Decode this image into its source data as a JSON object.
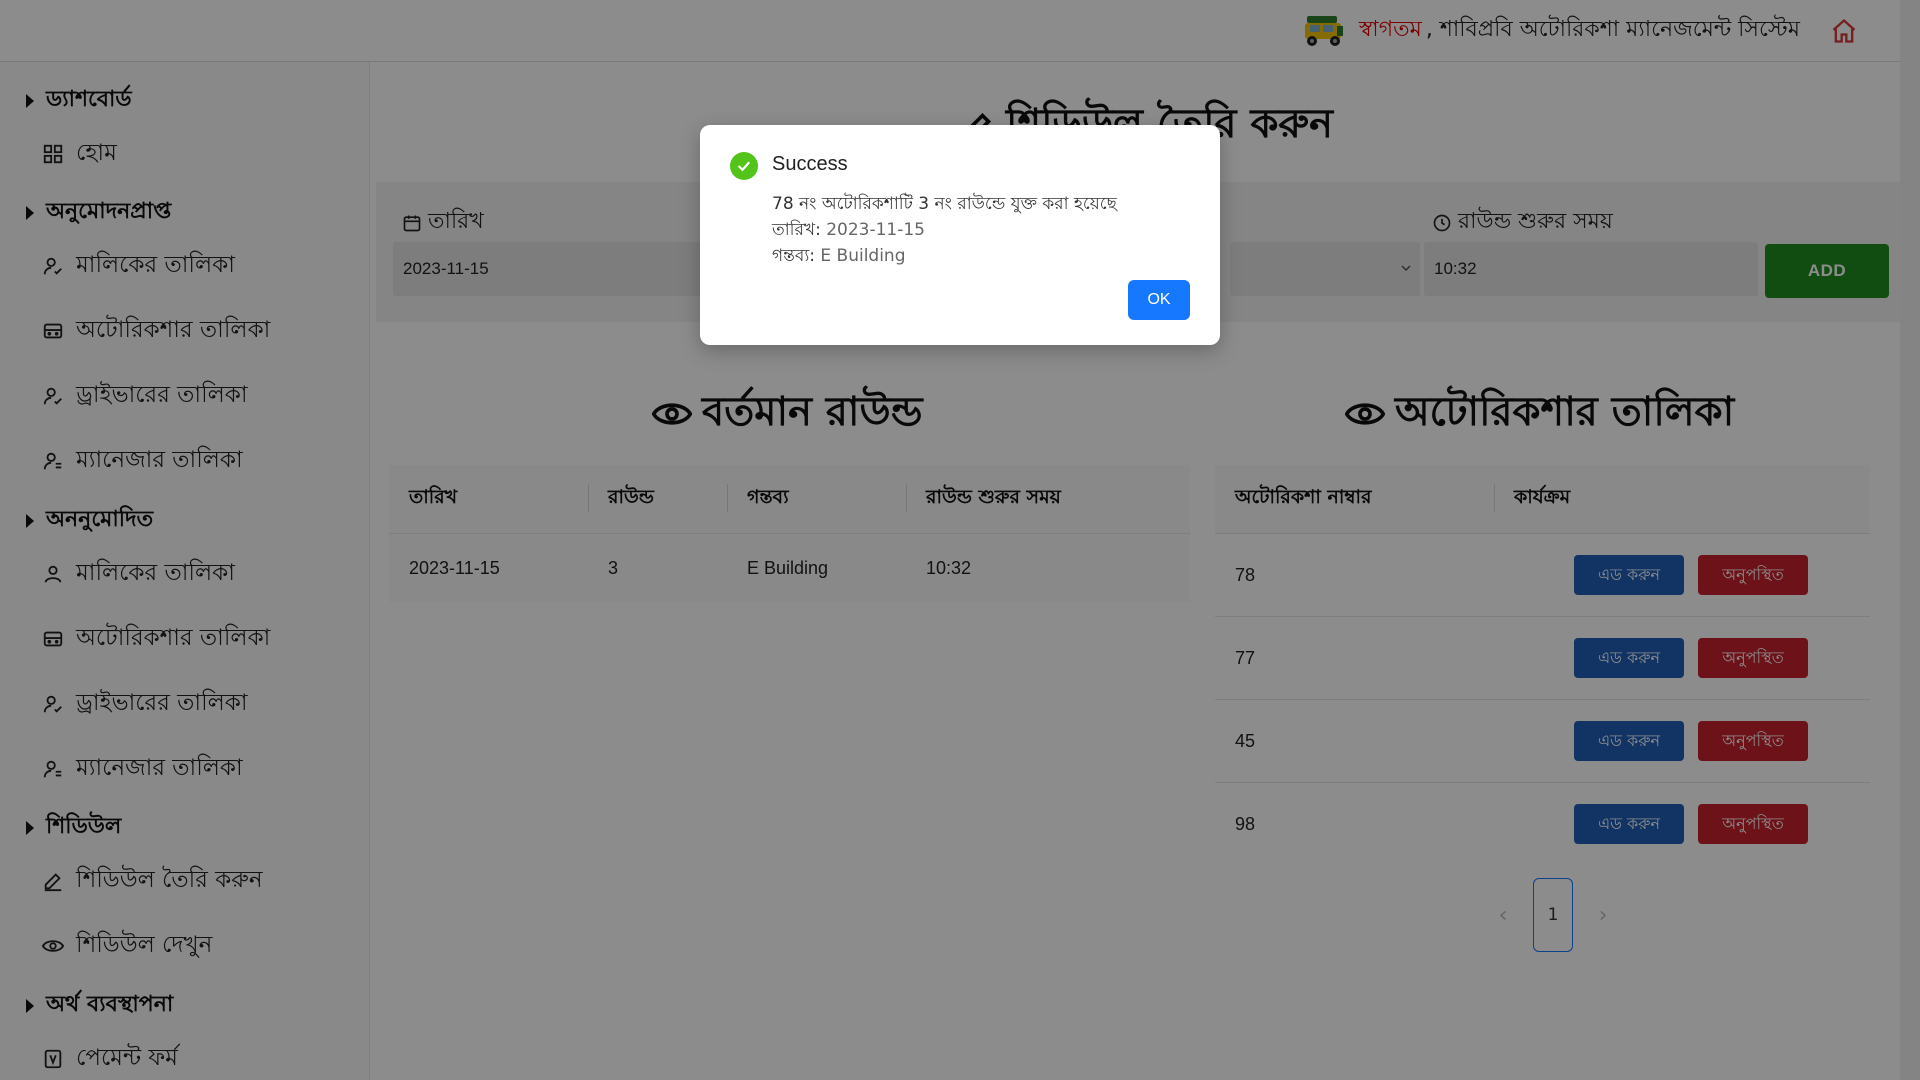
{
  "header": {
    "welcome": "স্বাগতম",
    "system_name": ", শাবিপ্রবি অটোরিকশা ম্যানেজমেন্ট সিস্টেম"
  },
  "sidebar": {
    "sections": [
      {
        "label": "ড্যাশবোর্ড",
        "items": [
          {
            "label": "হোম",
            "icon": "grid-icon"
          }
        ]
      },
      {
        "label": "অনুমোদনপ্রাপ্ত",
        "items": [
          {
            "label": "মালিকের তালিকা",
            "icon": "user-check-icon"
          },
          {
            "label": "অটোরিকশার তালিকা",
            "icon": "car-icon"
          },
          {
            "label": "ড্রাইভারের তালিকা",
            "icon": "user-check-icon"
          },
          {
            "label": "ম্যানেজার তালিকা",
            "icon": "user-settings-icon"
          }
        ]
      },
      {
        "label": "অননুমোদিত",
        "items": [
          {
            "label": "মালিকের তালিকা",
            "icon": "user-icon"
          },
          {
            "label": "অটোরিকশার তালিকা",
            "icon": "car-icon"
          },
          {
            "label": "ড্রাইভারের তালিকা",
            "icon": "user-check-icon"
          },
          {
            "label": "ম্যানেজার তালিকা",
            "icon": "user-settings-icon"
          }
        ]
      },
      {
        "label": "শিডিউল",
        "items": [
          {
            "label": "শিডিউল তৈরি করুন",
            "icon": "edit-icon"
          },
          {
            "label": "শিডিউল দেখুন",
            "icon": "eye-icon"
          }
        ]
      },
      {
        "label": "অর্থ ব্যবস্থাপনা",
        "items": [
          {
            "label": "পেমেন্ট ফর্ম",
            "icon": "taka-icon"
          }
        ]
      }
    ]
  },
  "main": {
    "page_title": "শিডিউল তৈরি করুন",
    "form": {
      "date_label": "তারিখ",
      "date_value": "2023-11-15",
      "time_label": "রাউন্ড শুরুর সময়",
      "time_value": "10:32",
      "add_label": "ADD"
    },
    "current_round": {
      "title": "বর্তমান রাউন্ড",
      "columns": [
        "তারিখ",
        "রাউন্ড",
        "গন্তব্য",
        "রাউন্ড শুরুর সময়"
      ],
      "rows": [
        [
          "2023-11-15",
          "3",
          "E Building",
          "10:32"
        ]
      ]
    },
    "autorickshaw_list": {
      "title": "অটোরিকশার তালিকা",
      "columns": [
        "অটোরিকশা নাম্বার",
        "কার্যক্রম"
      ],
      "add_btn": "এড করুন",
      "absent_btn": "অনুপস্থিত",
      "rows": [
        "78",
        "77",
        "45",
        "98"
      ]
    },
    "pagination": {
      "current": "1",
      "prev": "‹",
      "next": "›"
    }
  },
  "modal": {
    "title": "Success",
    "line1": "78 নং অটোরিকশাটি 3 নং রাউন্ডে যুক্ত করা হয়েছে",
    "line2_label": "তারিখ:",
    "line2_value": "2023-11-15",
    "line3_label": "গন্তব্য:",
    "line3_value": "E Building",
    "ok_label": "OK"
  }
}
